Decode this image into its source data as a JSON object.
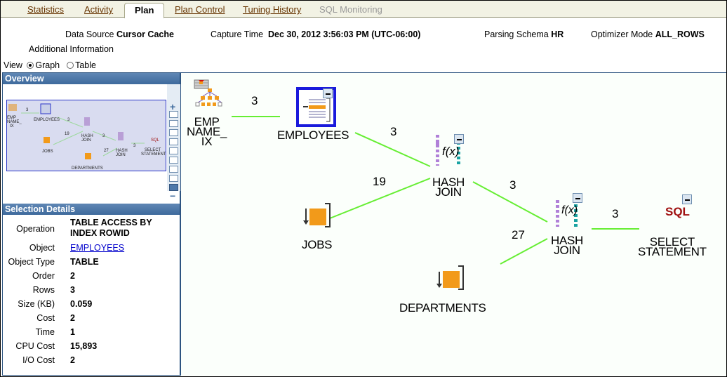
{
  "tabs": [
    {
      "label": "Statistics",
      "state": "link"
    },
    {
      "label": "Activity",
      "state": "link"
    },
    {
      "label": "Plan",
      "state": "active"
    },
    {
      "label": "Plan Control",
      "state": "link"
    },
    {
      "label": "Tuning History",
      "state": "link"
    },
    {
      "label": "SQL Monitoring",
      "state": "disabled"
    }
  ],
  "info": {
    "data_source_label": "Data Source",
    "data_source_value": "Cursor Cache",
    "capture_time_label": "Capture Time",
    "capture_time_value": "Dec 30, 2012 3:56:03 PM (UTC-06:00)",
    "parsing_schema_label": "Parsing Schema",
    "parsing_schema_value": "HR",
    "optimizer_mode_label": "Optimizer Mode",
    "optimizer_mode_value": "ALL_ROWS",
    "additional_info_label": "Additional Information"
  },
  "view": {
    "label": "View",
    "options": [
      {
        "label": "Graph",
        "selected": true
      },
      {
        "label": "Table",
        "selected": false
      }
    ]
  },
  "overview": {
    "title": "Overview",
    "zoom_in": "+",
    "zoom_out": "−",
    "zoom_level": 9,
    "zoom_levels": 9
  },
  "selection_details": {
    "title": "Selection Details",
    "rows": [
      {
        "key": "Operation",
        "value": "TABLE ACCESS BY INDEX ROWID"
      },
      {
        "key": "Object",
        "value": "EMPLOYEES",
        "link": true
      },
      {
        "key": "Object Type",
        "value": "TABLE"
      },
      {
        "key": "Order",
        "value": "2"
      },
      {
        "key": "Rows",
        "value": "3"
      },
      {
        "key": "Size (KB)",
        "value": "0.059"
      },
      {
        "key": "Cost",
        "value": "2"
      },
      {
        "key": "Time",
        "value": "1"
      },
      {
        "key": "CPU Cost",
        "value": "15,893"
      },
      {
        "key": "I/O Cost",
        "value": "2"
      }
    ]
  },
  "graph": {
    "nodes": [
      {
        "id": "idx",
        "label": "EMP\nNAME_\nIX",
        "icon": "index-icon"
      },
      {
        "id": "emp",
        "label": "EMPLOYEES",
        "icon": "table-access-icon",
        "selected": true
      },
      {
        "id": "hj1",
        "label": "HASH\nJOIN",
        "icon": "hash-join-icon",
        "fx": "f(x)"
      },
      {
        "id": "jobs",
        "label": "JOBS",
        "icon": "full-table-scan-icon"
      },
      {
        "id": "hj2",
        "label": "HASH\nJOIN",
        "icon": "hash-join-icon",
        "fx": "f(x)"
      },
      {
        "id": "dept",
        "label": "DEPARTMENTS",
        "icon": "full-table-scan-icon"
      },
      {
        "id": "sel",
        "label": "SELECT\nSTATEMENT",
        "icon": "sql-icon",
        "sql": "SQL"
      }
    ],
    "edges": [
      {
        "from": "idx",
        "to": "emp",
        "rows": "3"
      },
      {
        "from": "emp",
        "to": "hj1",
        "rows": "3"
      },
      {
        "from": "jobs",
        "to": "hj1",
        "rows": "19"
      },
      {
        "from": "hj1",
        "to": "hj2",
        "rows": "3"
      },
      {
        "from": "dept",
        "to": "hj2",
        "rows": "27"
      },
      {
        "from": "hj2",
        "to": "sel",
        "rows": "3"
      }
    ],
    "edge_color": "#66ee33",
    "selection_color": "#1a1adc"
  }
}
